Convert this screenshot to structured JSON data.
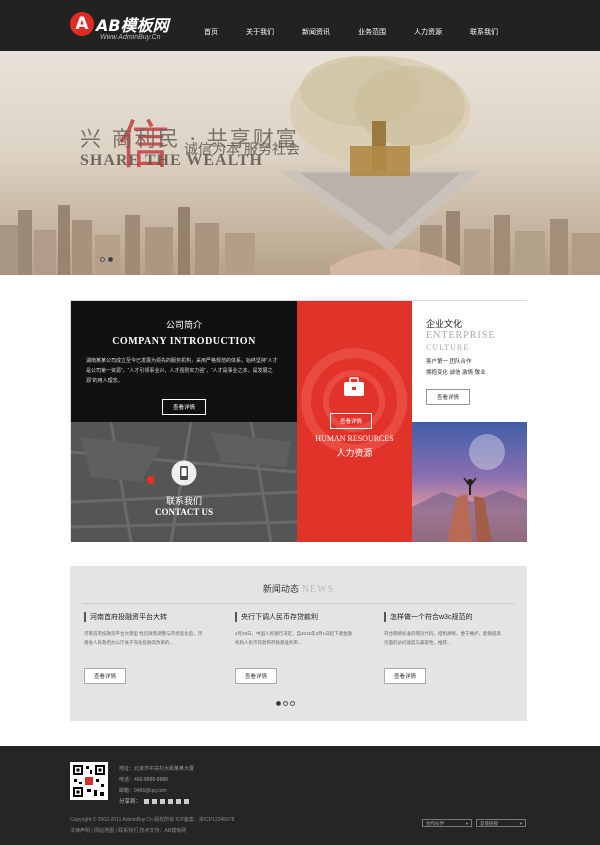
{
  "header": {
    "logo_text": "AB模板网",
    "logo_url": "Www.AdminBuy.Cn",
    "nav": [
      "首页",
      "关于我们",
      "新闻资讯",
      "业务范围",
      "人力资源",
      "联系我们"
    ]
  },
  "banner": {
    "title_zh": "兴 商利民 · 共享财富",
    "title_en": "SHARE THE WEALTH",
    "slogan": "诚信为本 服务社会",
    "brush": "信"
  },
  "intro": {
    "title_zh": "公司简介",
    "title_en": "COMPANY INTRODUCTION",
    "desc": "湖南某某公司成立至今已发展为领先的服务机构，采用严格规范的体系，始终坚持“人才是公司第一资源”，“人才引领事业兴，人才强则实力强”，“人才是事业之本，是发展之源”的用人理念。",
    "button": "查看详情"
  },
  "hr": {
    "button": "查看详情",
    "title_en": "HUMAN RESOURCES",
    "title_zh": "人力资源"
  },
  "culture": {
    "title_zh": "企业文化",
    "title_en1": "ENTERPRISE",
    "title_en2": "CULTURE",
    "line1": "客户第一   团队合作",
    "line2": "拥抱变化  诚信  激情  敬业",
    "button": "查看详情"
  },
  "contact": {
    "title_zh": "联系我们",
    "title_en": "CONTACT US"
  },
  "news": {
    "title_zh": "新闻动态",
    "title_en": "NEWS",
    "items": [
      {
        "title": "河南首府投融资平台大转",
        "desc": "河南首府投融资平台大转型 经历政策调整与市场变化后，河南省人民政府办公厅关于深化投融资改革的...",
        "button": "查看详情"
      },
      {
        "title": "央行下调人民币存贷款利",
        "desc": "2月28日，中国人民银行决定，自2015年3月1日起下调金融机构人民币贷款和存款基准利率...",
        "button": "查看详情"
      },
      {
        "title": "怎样做一个符合w3c规范的",
        "desc": "符合网络标准的网页代码，结构清晰、便于维护，能够提高页面的访问速度与兼容性，推荐...",
        "button": "查看详情"
      }
    ]
  },
  "footer": {
    "address": "地址：北京市中关村大街某某大厦",
    "phone": "电话：400-8888-8888",
    "email": "邮箱：9466@qq.com",
    "share_label": "分享到：",
    "copyright": "Copyright © 2002-2011 AdminBuy.Cn 版权所有   ICP备案：京ICP12345678",
    "links": "法律声明 | 网站地图 | 联系我们     技术支持：AB模板网",
    "select1": "合作伙伴",
    "select2": "友情链接"
  }
}
